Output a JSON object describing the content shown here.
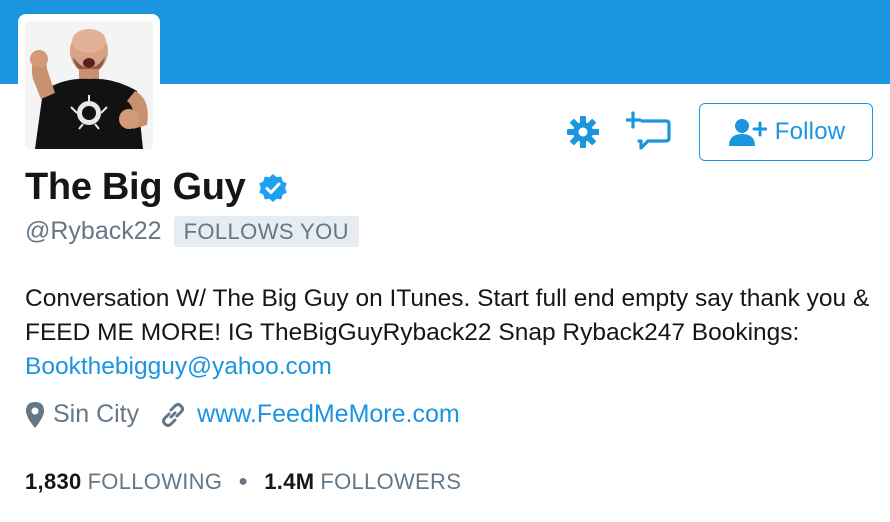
{
  "profile": {
    "display_name": "The Big Guy",
    "handle": "@Ryback22",
    "follows_you_badge": "FOLLOWS YOU",
    "verified": true
  },
  "actions": {
    "settings_icon": "gear-icon",
    "message_icon": "direct-message-icon",
    "follow_label": "Follow",
    "follow_icon": "add-user-icon"
  },
  "bio": {
    "text": "Conversation W/ The Big Guy on ITunes. Start full end empty say thank you & FEED ME MORE! IG TheBigGuyRyback22 Snap Ryback247 Bookings: ",
    "email_link": "Bookthebigguy@yahoo.com"
  },
  "meta": {
    "location": "Sin City",
    "website": "www.FeedMeMore.com",
    "location_icon": "location-pin-icon",
    "website_icon": "link-icon"
  },
  "stats": {
    "following_count": "1,830",
    "following_label": "FOLLOWING",
    "followers_count": "1.4M",
    "followers_label": "FOLLOWERS"
  },
  "colors": {
    "brand_blue": "#1b95e0",
    "text_dark": "#14171a",
    "text_muted": "#657786",
    "badge_bg": "#e6ecf0"
  }
}
